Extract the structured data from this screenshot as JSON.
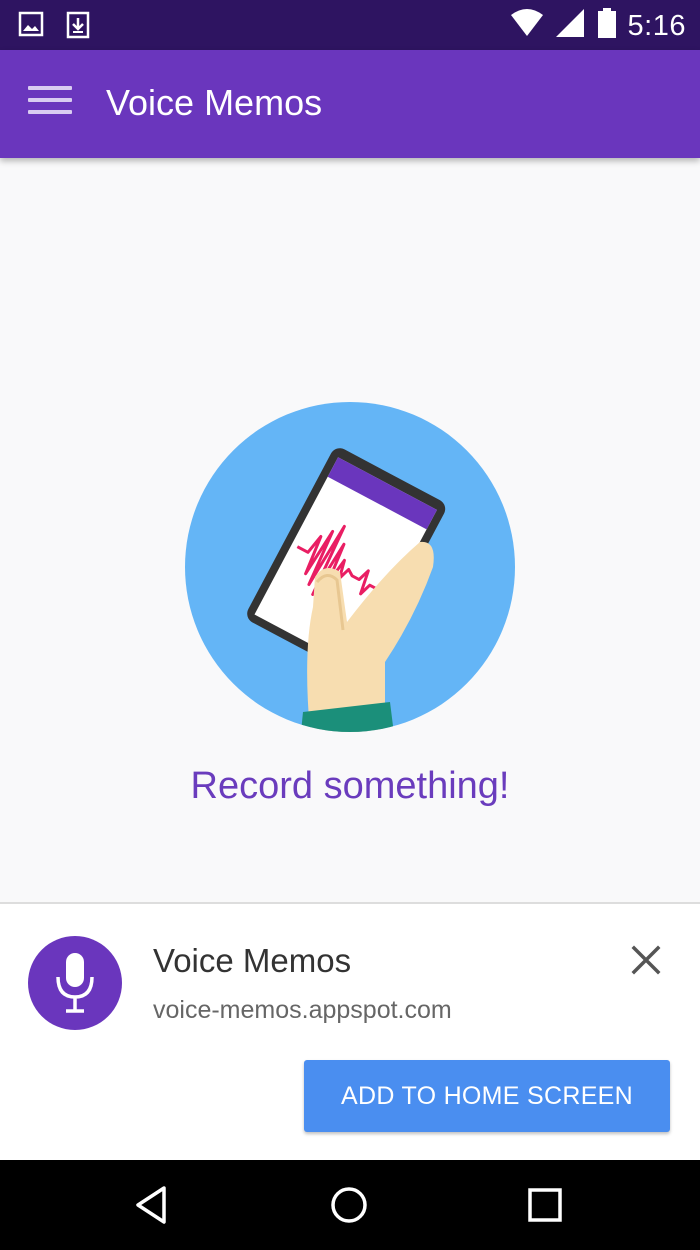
{
  "status_bar": {
    "time": "5:16",
    "notification_icons": [
      "image-icon",
      "download-icon"
    ],
    "system_icons": [
      "wifi-icon",
      "signal-icon",
      "battery-icon"
    ]
  },
  "app_bar": {
    "title": "Voice Memos",
    "menu_icon": "hamburger-menu-icon",
    "color": "#6a36bd"
  },
  "main": {
    "illustration": "hand-holding-phone-recording-icon",
    "empty_message": "Record something!"
  },
  "install_banner": {
    "app_name": "Voice Memos",
    "url": "voice-memos.appspot.com",
    "app_icon": "microphone-icon",
    "close_icon": "close-icon",
    "button_label": "ADD TO HOME SCREEN",
    "button_color": "#4a8ef0"
  },
  "nav_bar": {
    "icons": [
      "back-icon",
      "home-icon",
      "recents-icon"
    ]
  },
  "colors": {
    "status_bar": "#2e1461",
    "accent_text": "#6a3cbd",
    "illustration_bg": "#64b5f6",
    "waveform": "#e91e63"
  }
}
